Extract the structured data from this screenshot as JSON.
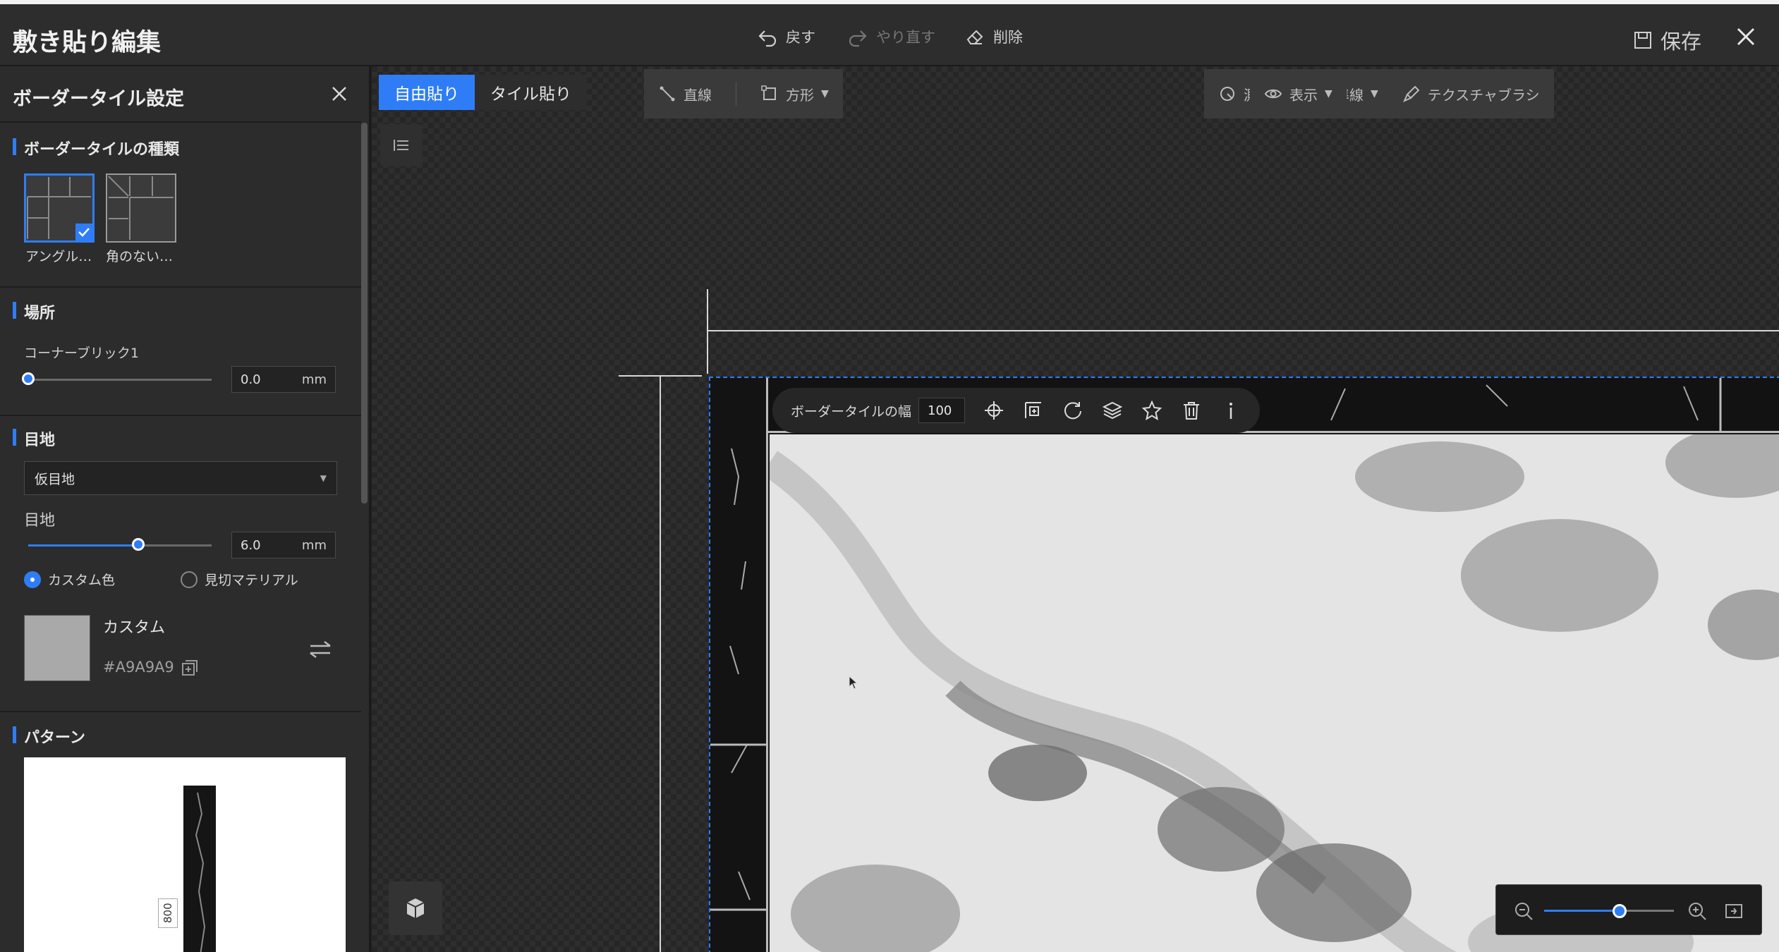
{
  "app": {
    "title": "敷き貼り編集",
    "undo_label": "戻す",
    "redo_label": "やり直す",
    "delete_label": "削除",
    "save_label": "保存"
  },
  "panel": {
    "title": "ボーダータイル設定",
    "type_section": "ボーダータイルの種類",
    "types": [
      {
        "label": "アングル…",
        "selected": true
      },
      {
        "label": "角のない…",
        "selected": false
      }
    ],
    "location_section": "場所",
    "corner_label": "コーナーブリック1",
    "corner_value": "0.0",
    "corner_unit": "mm",
    "corner_slider_fraction": 0.0,
    "joint_section": "目地",
    "joint_select": "仮目地",
    "joint_label": "目地",
    "joint_value": "6.0",
    "joint_unit": "mm",
    "joint_slider_fraction": 0.6,
    "radio_custom": "カスタム色",
    "radio_material": "見切マテリアル",
    "radio_selected": "custom",
    "color_name": "カスタム",
    "color_hex": "#A9A9A9",
    "pattern_section": "パターン",
    "pattern_dim": "800"
  },
  "canvas": {
    "tabs": [
      {
        "label": "自由貼り",
        "active": true
      },
      {
        "label": "タイル貼り",
        "active": false
      }
    ],
    "tools": {
      "line": "直線",
      "rect": "方形",
      "measure": "測定",
      "baseline": "基準線",
      "texture_brush": "テクスチャブラシ",
      "view": "表示"
    },
    "float_toolbar": {
      "width_label": "ボーダータイルの幅",
      "width_value": "100"
    },
    "zoom_fraction": 0.58
  },
  "colors": {
    "accent": "#2f7df6",
    "joint_color": "#A9A9A9"
  },
  "icons": [
    "undo-icon",
    "redo-icon",
    "eraser-icon",
    "save-icon",
    "close-icon",
    "check-icon",
    "copy-icon",
    "swap-icon",
    "list-icon",
    "cube-icon",
    "line-icon",
    "rect-icon",
    "chevron-down-icon",
    "measure-icon",
    "baseline-icon",
    "brush-icon",
    "eye-icon",
    "target-icon",
    "layout-add-icon",
    "rotate-icon",
    "layers-icon",
    "star-icon",
    "trash-icon",
    "info-icon",
    "zoom-out-icon",
    "zoom-in-icon",
    "fit-icon"
  ]
}
